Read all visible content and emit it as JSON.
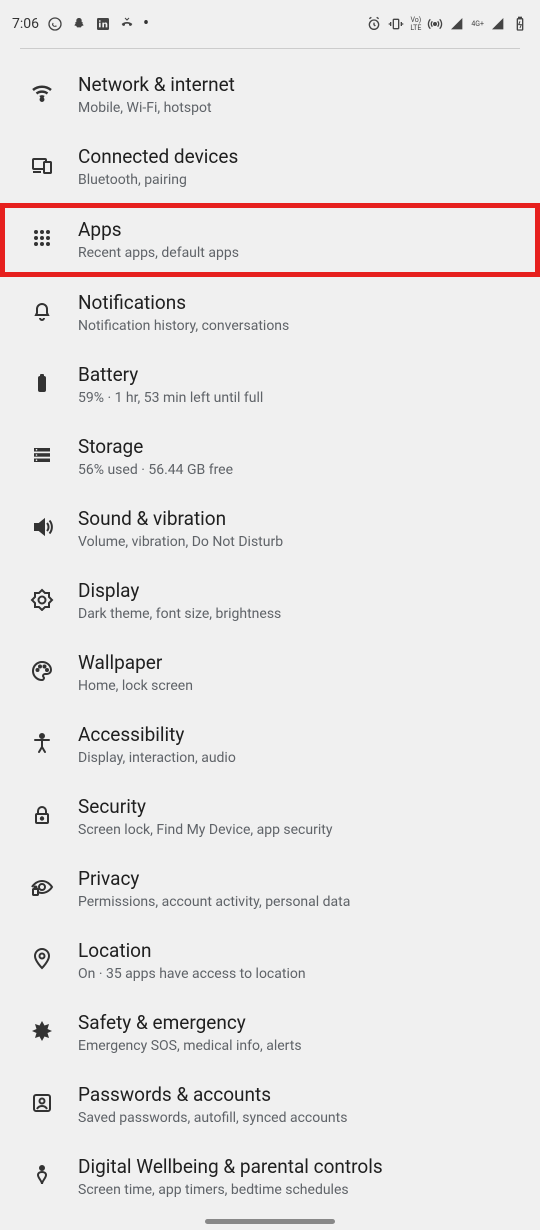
{
  "status": {
    "time": "7:06",
    "net_badge": "4G+",
    "volte": "Vo)\nLTE"
  },
  "items": [
    {
      "title": "Network & internet",
      "sub": "Mobile, Wi-Fi, hotspot"
    },
    {
      "title": "Connected devices",
      "sub": "Bluetooth, pairing"
    },
    {
      "title": "Apps",
      "sub": "Recent apps, default apps"
    },
    {
      "title": "Notifications",
      "sub": "Notification history, conversations"
    },
    {
      "title": "Battery",
      "sub": "59% · 1 hr, 53 min left until full"
    },
    {
      "title": "Storage",
      "sub": "56% used · 56.44 GB free"
    },
    {
      "title": "Sound & vibration",
      "sub": "Volume, vibration, Do Not Disturb"
    },
    {
      "title": "Display",
      "sub": "Dark theme, font size, brightness"
    },
    {
      "title": "Wallpaper",
      "sub": "Home, lock screen"
    },
    {
      "title": "Accessibility",
      "sub": "Display, interaction, audio"
    },
    {
      "title": "Security",
      "sub": "Screen lock, Find My Device, app security"
    },
    {
      "title": "Privacy",
      "sub": "Permissions, account activity, personal data"
    },
    {
      "title": "Location",
      "sub": "On · 35 apps have access to location"
    },
    {
      "title": "Safety & emergency",
      "sub": "Emergency SOS, medical info, alerts"
    },
    {
      "title": "Passwords & accounts",
      "sub": "Saved passwords, autofill, synced accounts"
    },
    {
      "title": "Digital Wellbeing & parental controls",
      "sub": "Screen time, app timers, bedtime schedules"
    }
  ]
}
